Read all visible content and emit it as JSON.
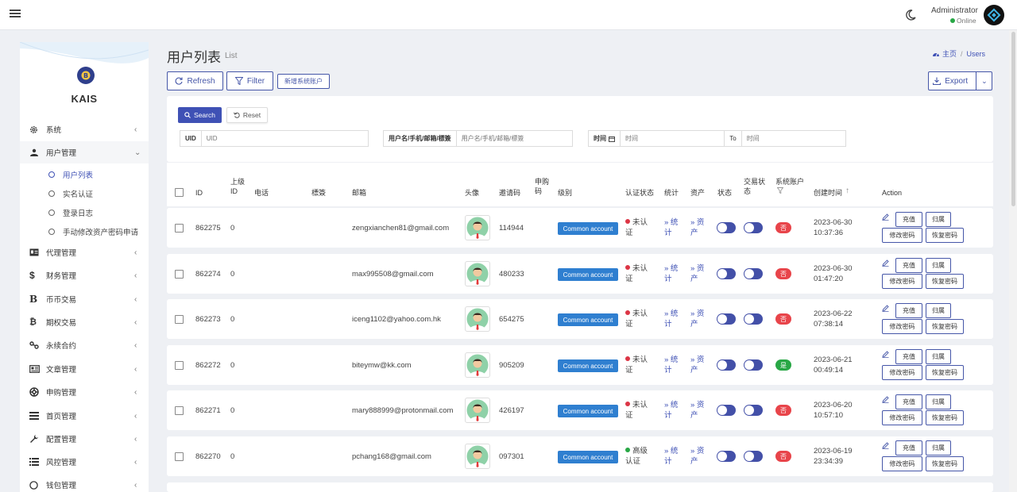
{
  "topbar": {
    "admin_name": "Administrator",
    "admin_status": "Online"
  },
  "sidebar": {
    "logo_text": "KAIS",
    "menu": [
      {
        "label": "系统",
        "icon": "gear-icon"
      },
      {
        "label": "用户管理",
        "icon": "users-icon"
      },
      {
        "label": "代理管理",
        "icon": "id-card-icon"
      },
      {
        "label": "财务管理",
        "icon": "dollar-icon"
      },
      {
        "label": "币币交易",
        "icon": "bitcoin-icon"
      },
      {
        "label": "期权交易",
        "icon": "bitcoin-circle-icon"
      },
      {
        "label": "永续合约",
        "icon": "link-icon"
      },
      {
        "label": "文章管理",
        "icon": "newspaper-icon"
      },
      {
        "label": "申购管理",
        "icon": "lifebuoy-icon"
      },
      {
        "label": "首页管理",
        "icon": "list-icon"
      },
      {
        "label": "配置管理",
        "icon": "wrench-icon"
      },
      {
        "label": "风控管理",
        "icon": "list-ordered-icon"
      },
      {
        "label": "钱包管理",
        "icon": "circle-icon"
      }
    ],
    "submenu": [
      {
        "label": "用户列表"
      },
      {
        "label": "实名认证"
      },
      {
        "label": "登录日志"
      },
      {
        "label": "手动修改资产密码申请"
      }
    ]
  },
  "header": {
    "title": "用户列表",
    "subtitle": "List",
    "breadcrumb_home": "主页",
    "breadcrumb_current": "Users"
  },
  "toolbar": {
    "refresh": "Refresh",
    "filter": "Filter",
    "new_system_account": "新增系统账户",
    "export": "Export"
  },
  "filters": {
    "search": "Search",
    "reset": "Reset",
    "uid_label": "UID",
    "uid_placeholder": "UID",
    "user_label": "用户名/手机/邮箱/標簽",
    "user_placeholder": "用户名/手机/邮箱/標簽",
    "time_label": "时间",
    "time_placeholder": "时间",
    "to_label": "To",
    "time_to_placeholder": "时间"
  },
  "table": {
    "headers": {
      "id": "ID",
      "parent_id": "上级 ID",
      "phone": "电话",
      "tag": "標簽",
      "email": "邮箱",
      "avatar": "头像",
      "invite": "邀请码",
      "subscribe": "申购 码",
      "level": "级别",
      "auth": "认证状态",
      "stats": "统计",
      "assets": "资产",
      "status": "状态",
      "trade_status": "交易状 态",
      "system_account": "系统账户",
      "created": "创建时间",
      "action": "Action"
    },
    "action_labels": {
      "recharge": "充值",
      "return": "归属",
      "change_password": "修改密码",
      "reset_password": "恢复密码"
    },
    "rows": [
      {
        "id": "862275",
        "parent": "0",
        "email": "zengxianchen81@gmail.com",
        "invite": "114944",
        "level": "Common account",
        "auth_line1": "未认",
        "auth_line2": "证",
        "auth_color": "#dc3545",
        "stats_line1": "» 统",
        "stats_line2": "计",
        "assets_line1": "» 资",
        "assets_line2": "产",
        "sys": "否",
        "sys_color": "#e8444a",
        "date": "2023-06-30",
        "time": "10:37:36"
      },
      {
        "id": "862274",
        "parent": "0",
        "email": "max995508@gmail.com",
        "invite": "480233",
        "level": "Common account",
        "auth_line1": "未认",
        "auth_line2": "证",
        "auth_color": "#dc3545",
        "stats_line1": "» 统",
        "stats_line2": "计",
        "assets_line1": "» 资",
        "assets_line2": "产",
        "sys": "否",
        "sys_color": "#e8444a",
        "date": "2023-06-30",
        "time": "01:47:20"
      },
      {
        "id": "862273",
        "parent": "0",
        "email": "iceng1102@yahoo.com.hk",
        "invite": "654275",
        "level": "Common account",
        "auth_line1": "未认",
        "auth_line2": "证",
        "auth_color": "#dc3545",
        "stats_line1": "» 统",
        "stats_line2": "计",
        "assets_line1": "» 资",
        "assets_line2": "产",
        "sys": "否",
        "sys_color": "#e8444a",
        "date": "2023-06-22",
        "time": "07:38:14"
      },
      {
        "id": "862272",
        "parent": "0",
        "email": "biteymw@kk.com",
        "invite": "905209",
        "level": "Common account",
        "auth_line1": "未认",
        "auth_line2": "证",
        "auth_color": "#dc3545",
        "stats_line1": "» 统",
        "stats_line2": "计",
        "assets_line1": "» 资",
        "assets_line2": "产",
        "sys": "是",
        "sys_color": "#28a745",
        "date": "2023-06-21",
        "time": "00:49:14"
      },
      {
        "id": "862271",
        "parent": "0",
        "email": "mary888999@protonmail.com",
        "invite": "426197",
        "level": "Common account",
        "auth_line1": "未认",
        "auth_line2": "证",
        "auth_color": "#dc3545",
        "stats_line1": "» 统",
        "stats_line2": "计",
        "assets_line1": "» 资",
        "assets_line2": "产",
        "sys": "否",
        "sys_color": "#e8444a",
        "date": "2023-06-20",
        "time": "10:57:10"
      },
      {
        "id": "862270",
        "parent": "0",
        "email": "pchang168@gmail.com",
        "invite": "097301",
        "level": "Common account",
        "auth_line1": "高级",
        "auth_line2": "认证",
        "auth_color": "#28a745",
        "stats_line1": "» 统",
        "stats_line2": "计",
        "assets_line1": "» 资",
        "assets_line2": "产",
        "sys": "否",
        "sys_color": "#e8444a",
        "date": "2023-06-19",
        "time": "23:34:39"
      }
    ]
  },
  "colors": {
    "primary": "#3f51b5",
    "badge_blue": "#2f7fd0",
    "danger": "#e8444a",
    "success": "#28a745"
  }
}
